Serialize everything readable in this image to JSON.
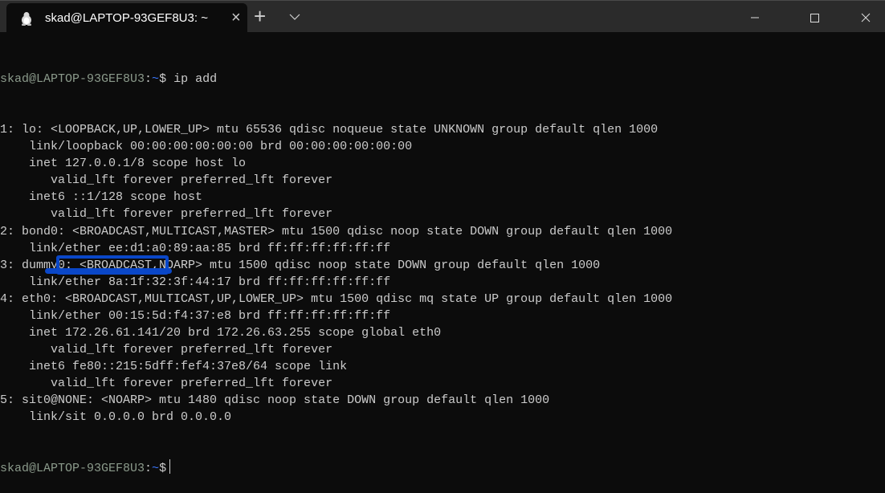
{
  "window": {
    "tab_title": "skad@LAPTOP-93GEF8U3: ~",
    "tab_icon": "linux-penguin-icon",
    "new_tab_label": "+",
    "close_tab_label": "×"
  },
  "terminal": {
    "prompt_user": "skad@LAPTOP-93GEF8U3",
    "prompt_sep": ":",
    "prompt_path": "~",
    "prompt_symbol": "$",
    "command": " ip add",
    "output": [
      "1: lo: <LOOPBACK,UP,LOWER_UP> mtu 65536 qdisc noqueue state UNKNOWN group default qlen 1000",
      "    link/loopback 00:00:00:00:00:00 brd 00:00:00:00:00:00",
      "    inet 127.0.0.1/8 scope host lo",
      "       valid_lft forever preferred_lft forever",
      "    inet6 ::1/128 scope host",
      "       valid_lft forever preferred_lft forever",
      "2: bond0: <BROADCAST,MULTICAST,MASTER> mtu 1500 qdisc noop state DOWN group default qlen 1000",
      "    link/ether ee:d1:a0:89:aa:85 brd ff:ff:ff:ff:ff:ff",
      "3: dummy0: <BROADCAST,NOARP> mtu 1500 qdisc noop state DOWN group default qlen 1000",
      "    link/ether 8a:1f:32:3f:44:17 brd ff:ff:ff:ff:ff:ff",
      "4: eth0: <BROADCAST,MULTICAST,UP,LOWER_UP> mtu 1500 qdisc mq state UP group default qlen 1000",
      "    link/ether 00:15:5d:f4:37:e8 brd ff:ff:ff:ff:ff:ff",
      "    inet 172.26.61.141/20 brd 172.26.63.255 scope global eth0",
      "       valid_lft forever preferred_lft forever",
      "    inet6 fe80::215:5dff:fef4:37e8/64 scope link",
      "       valid_lft forever preferred_lft forever",
      "5: sit0@NONE: <NOARP> mtu 1480 qdisc noop state DOWN group default qlen 1000",
      "    link/sit 0.0.0.0 brd 0.0.0.0"
    ]
  },
  "colors": {
    "annotation": "#0a47c8",
    "prompt_user": "#8b9a8b",
    "prompt_path": "#3b78ff"
  }
}
